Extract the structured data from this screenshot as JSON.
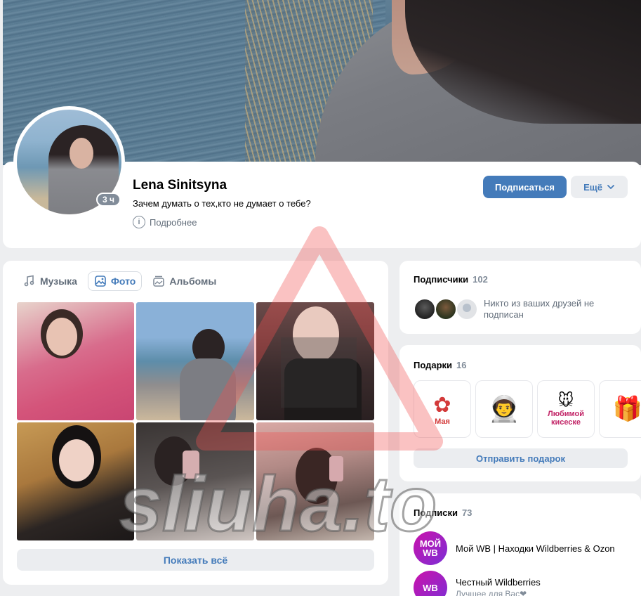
{
  "profile": {
    "name": "Lena Sinitsyna",
    "status": "Зачем думать о тех,кто не думает о тебе?",
    "more_info": "Подробнее",
    "last_seen": "3 ч",
    "subscribe_label": "Подписаться",
    "more_label": "Ещё"
  },
  "media": {
    "tabs": [
      {
        "label": "Музыка",
        "icon": "music-note-icon",
        "active": false
      },
      {
        "label": "Фото",
        "icon": "photo-icon",
        "active": true
      },
      {
        "label": "Альбомы",
        "icon": "albums-icon",
        "active": false
      }
    ],
    "show_all_label": "Показать всё"
  },
  "followers": {
    "title": "Подписчики",
    "count": "102",
    "note": "Никто из ваших друзей не подписан"
  },
  "gifts": {
    "title": "Подарки",
    "count": "16",
    "items": [
      {
        "text": "Мая",
        "icon": "flowers-gift-icon"
      },
      {
        "text": "",
        "icon": "astronaut-gift-icon"
      },
      {
        "text": "Любимой кисеске",
        "icon": "mouse-gift-icon"
      },
      {
        "text": "",
        "icon": "gift-box-icon"
      }
    ],
    "send_label": "Отправить подарок"
  },
  "subscriptions": {
    "title": "Подписки",
    "count": "73",
    "items": [
      {
        "logo": "МОЙ WB",
        "name": "Мой WB | Находки Wildberries & Ozon",
        "sub": ""
      },
      {
        "logo": "WB",
        "name": "Честный Wildberries",
        "sub": "Лучшее для Вас❤"
      }
    ]
  },
  "watermark": {
    "text": "sliuha.to"
  },
  "colors": {
    "accent": "#447bba",
    "button_secondary": "#ebedf0",
    "page_bg": "#edeef0",
    "muted": "#818c99"
  }
}
